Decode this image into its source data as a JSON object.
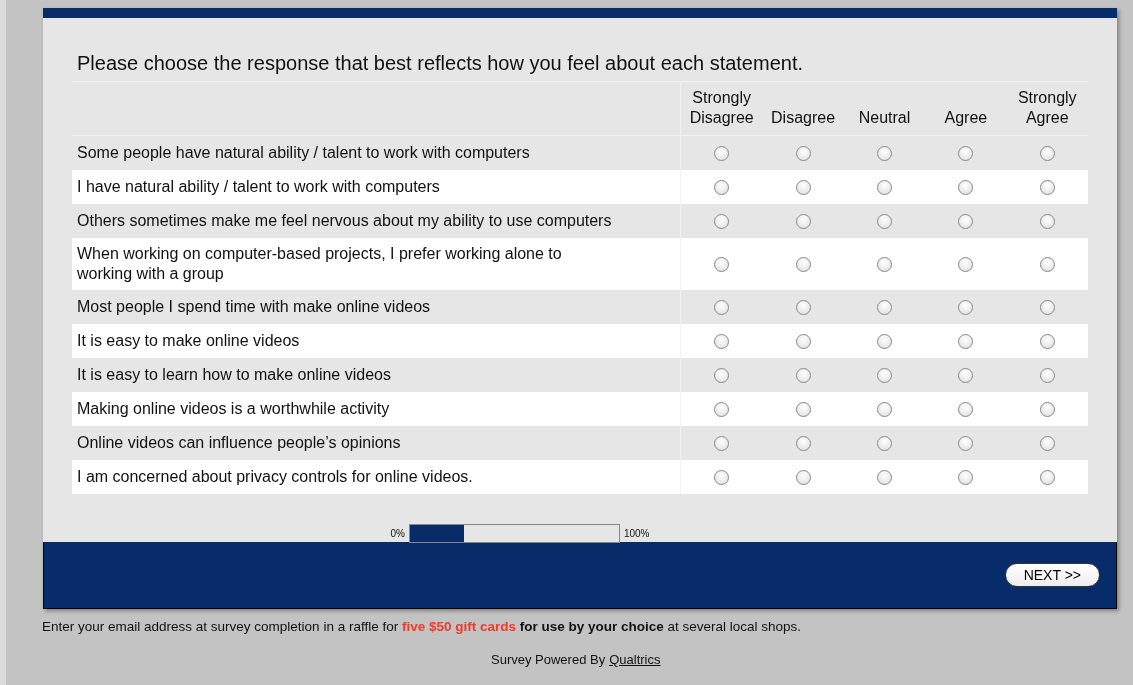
{
  "survey": {
    "instruction": "Please choose the response that best reflects how you feel about each statement.",
    "scale": [
      "Strongly Disagree",
      "Disagree",
      "Neutral",
      "Agree",
      "Strongly Agree"
    ],
    "rows": [
      {
        "statement": "Some people have natural ability / talent to work with computers",
        "options": [
          {
            "selected": false
          },
          {
            "selected": false
          },
          {
            "selected": false
          },
          {
            "selected": false
          },
          {
            "selected": false
          }
        ]
      },
      {
        "statement": "I have natural ability / talent to work with computers",
        "options": [
          {
            "selected": false
          },
          {
            "selected": false
          },
          {
            "selected": false
          },
          {
            "selected": false
          },
          {
            "selected": false
          }
        ]
      },
      {
        "statement": "Others sometimes make me feel nervous about my ability to use computers",
        "options": [
          {
            "selected": false
          },
          {
            "selected": false
          },
          {
            "selected": false
          },
          {
            "selected": false
          },
          {
            "selected": false
          }
        ]
      },
      {
        "statement": "When working on computer-based projects, I prefer working alone to working with a group",
        "options": [
          {
            "selected": false
          },
          {
            "selected": false
          },
          {
            "selected": false
          },
          {
            "selected": false
          },
          {
            "selected": false
          }
        ]
      },
      {
        "statement": "Most people I spend time with make online videos",
        "options": [
          {
            "selected": false
          },
          {
            "selected": false
          },
          {
            "selected": false
          },
          {
            "selected": false
          },
          {
            "selected": false
          }
        ]
      },
      {
        "statement": "It is easy to make online videos",
        "options": [
          {
            "selected": false
          },
          {
            "selected": false
          },
          {
            "selected": false
          },
          {
            "selected": false
          },
          {
            "selected": false
          }
        ]
      },
      {
        "statement": "It is easy to learn how to make online videos",
        "options": [
          {
            "selected": false
          },
          {
            "selected": false
          },
          {
            "selected": false
          },
          {
            "selected": false
          },
          {
            "selected": false
          }
        ]
      },
      {
        "statement": "Making online videos is a worthwhile activity",
        "options": [
          {
            "selected": false
          },
          {
            "selected": false
          },
          {
            "selected": false
          },
          {
            "selected": false
          },
          {
            "selected": false
          }
        ]
      },
      {
        "statement": "Online videos can influence people’s opinions",
        "options": [
          {
            "selected": false
          },
          {
            "selected": false
          },
          {
            "selected": false
          },
          {
            "selected": false
          },
          {
            "selected": false
          }
        ]
      },
      {
        "statement": "I am concerned about privacy controls for online videos.",
        "options": [
          {
            "selected": false
          },
          {
            "selected": false
          },
          {
            "selected": false
          },
          {
            "selected": false
          },
          {
            "selected": false
          }
        ]
      }
    ]
  },
  "progress": {
    "start_label": "0%",
    "end_label": "100%",
    "level": 0.26
  },
  "next_button": "NEXT >>",
  "note": [
    {
      "kind": "plain",
      "text": "Enter your email address at survey completion in a raffle for "
    },
    {
      "kind": "highlight",
      "text": "five $50 gift cards"
    },
    {
      "kind": "bold",
      "text": " for use by your choice"
    },
    {
      "kind": "plain",
      "text": " at several local shops."
    }
  ],
  "powered_by": {
    "text": "Survey Powered By",
    "link": "Qualtrics"
  }
}
